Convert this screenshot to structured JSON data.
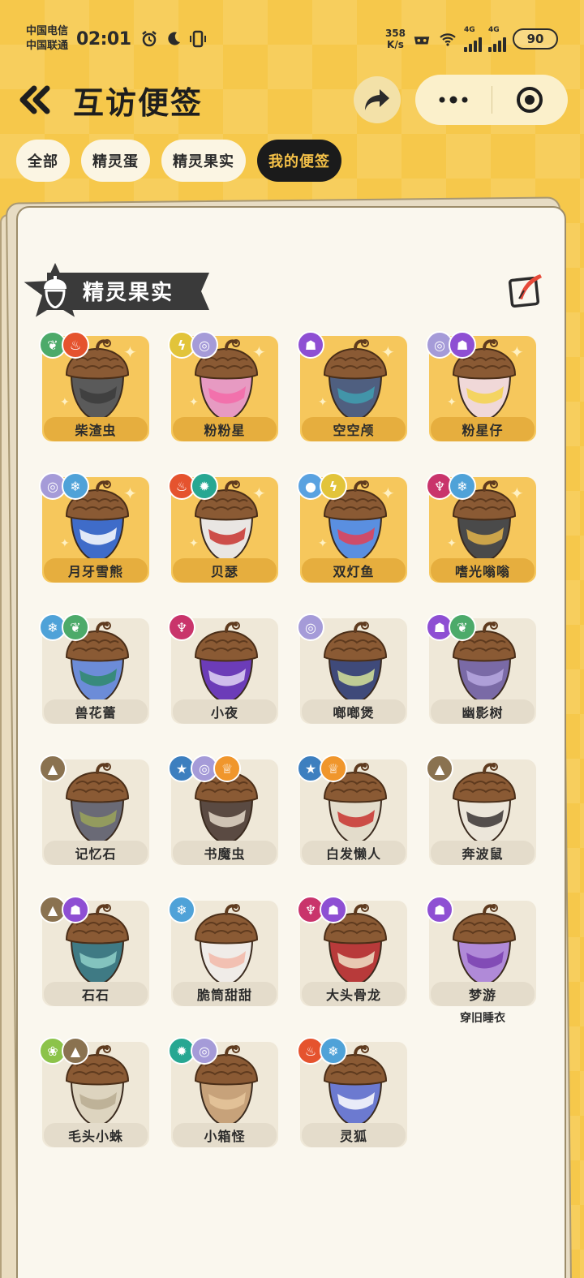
{
  "status": {
    "carrier1": "中国电信",
    "carrier2": "中国联通",
    "time": "02:01",
    "speed_value": "358",
    "speed_unit": "K/s",
    "network1": "4G",
    "network2": "4G",
    "battery": "90"
  },
  "header": {
    "title": "互访便签"
  },
  "tabs": [
    {
      "label": "全部"
    },
    {
      "label": "精灵蛋"
    },
    {
      "label": "精灵果实"
    },
    {
      "label": "我的便签"
    }
  ],
  "section": {
    "title": "精灵果实"
  },
  "colors": {
    "grass": "#4caa6a",
    "fire": "#e5532e",
    "electric": "#e2c43a",
    "psychic": "#a59bd8",
    "ghost": "#8e4fd3",
    "ice": "#4fa2d8",
    "water": "#5aa2e0",
    "demon": "#c9346b",
    "rock": "#8a7250",
    "star": "#3d7fbf",
    "crown": "#f0962c",
    "bug": "#8cc34a",
    "mecha": "#27a792"
  },
  "items": [
    {
      "name": "柴渣虫",
      "owned": true,
      "badges": [
        "grass",
        "fire"
      ],
      "shell": "#5a5a5a",
      "accent": "#3c3c3c"
    },
    {
      "name": "粉粉星",
      "owned": true,
      "badges": [
        "electric",
        "psychic"
      ],
      "shell": "#e79ac2",
      "accent": "#f36aa8"
    },
    {
      "name": "空空颅",
      "owned": true,
      "badges": [
        "ghost"
      ],
      "shell": "#4f5f80",
      "accent": "#3f9fb0"
    },
    {
      "name": "粉星仔",
      "owned": true,
      "badges": [
        "psychic",
        "ghost"
      ],
      "shell": "#f0d8d8",
      "accent": "#f4d34c"
    },
    {
      "name": "月牙雪熊",
      "owned": true,
      "badges": [
        "psychic",
        "ice"
      ],
      "shell": "#3f6cc9",
      "accent": "#ffffff"
    },
    {
      "name": "贝瑟",
      "owned": true,
      "badges": [
        "fire",
        "mecha"
      ],
      "shell": "#e9e6e3",
      "accent": "#c8322f"
    },
    {
      "name": "双灯鱼",
      "owned": true,
      "badges": [
        "water",
        "electric"
      ],
      "shell": "#5a8fe0",
      "accent": "#e34155"
    },
    {
      "name": "嗜光嗡嗡",
      "owned": true,
      "badges": [
        "demon",
        "ice"
      ],
      "shell": "#4a4a4a",
      "accent": "#e3b44a"
    },
    {
      "name": "兽花蕾",
      "owned": false,
      "badges": [
        "ice",
        "grass"
      ],
      "shell": "#6c8cd8",
      "accent": "#2f8a6c"
    },
    {
      "name": "小夜",
      "owned": false,
      "badges": [
        "demon"
      ],
      "shell": "#6c3cb8",
      "accent": "#e0d3f5"
    },
    {
      "name": "啷啷煲",
      "owned": false,
      "badges": [
        "psychic"
      ],
      "shell": "#3f4a7a",
      "accent": "#d6e39a"
    },
    {
      "name": "幽影树",
      "owned": false,
      "badges": [
        "ghost",
        "grass"
      ],
      "shell": "#7a6aa6",
      "accent": "#b7a8e0"
    },
    {
      "name": "记忆石",
      "owned": false,
      "badges": [
        "rock"
      ],
      "shell": "#6a6a76",
      "accent": "#9aa35a"
    },
    {
      "name": "书魔虫",
      "owned": false,
      "badges": [
        "star",
        "psychic",
        "crown"
      ],
      "shell": "#5a4a42",
      "accent": "#e4d8c8"
    },
    {
      "name": "白发懒人",
      "owned": false,
      "badges": [
        "star",
        "crown"
      ],
      "shell": "#e3dccb",
      "accent": "#c8322f"
    },
    {
      "name": "奔波鼠",
      "owned": false,
      "badges": [
        "rock"
      ],
      "shell": "#ece6da",
      "accent": "#3a3232"
    },
    {
      "name": "石石",
      "owned": false,
      "badges": [
        "rock",
        "ghost"
      ],
      "shell": "#3f7a84",
      "accent": "#8fd0c8"
    },
    {
      "name": "脆筒甜甜",
      "owned": false,
      "badges": [
        "ice"
      ],
      "shell": "#f0ece8",
      "accent": "#f2b8a8"
    },
    {
      "name": "大头骨龙",
      "owned": false,
      "badges": [
        "demon",
        "ghost"
      ],
      "shell": "#b83a3a",
      "accent": "#f0e2c8"
    },
    {
      "name": "梦游",
      "owned": false,
      "badges": [
        "ghost"
      ],
      "shell": "#b08ad8",
      "accent": "#7a3fb0",
      "subtitle": "穿旧睡衣"
    },
    {
      "name": "毛头小蛛",
      "owned": false,
      "badges": [
        "bug",
        "rock"
      ],
      "shell": "#ddd4bf",
      "accent": "#b8ac90"
    },
    {
      "name": "小箱怪",
      "owned": false,
      "badges": [
        "mecha",
        "psychic"
      ],
      "shell": "#c7a27a",
      "accent": "#e6c79c"
    },
    {
      "name": "灵狐",
      "owned": false,
      "badges": [
        "fire",
        "ice"
      ],
      "shell": "#6c7ad0",
      "accent": "#ffffff"
    }
  ]
}
